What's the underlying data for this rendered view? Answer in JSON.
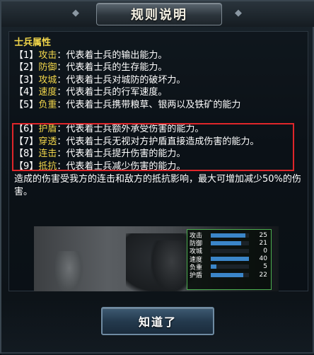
{
  "dialog": {
    "title": "规则说明",
    "ok_label": "知道了"
  },
  "section": {
    "title": "士兵属性"
  },
  "attributes": [
    {
      "num": "1",
      "name": "攻击",
      "desc": "代表着士兵的输出能力。"
    },
    {
      "num": "2",
      "name": "防御",
      "desc": "代表着士兵的生存能力。"
    },
    {
      "num": "3",
      "name": "攻城",
      "desc": "代表着士兵对城防的破坏力。"
    },
    {
      "num": "4",
      "name": "速度",
      "desc": "代表着士兵的行军速度。"
    },
    {
      "num": "5",
      "name": "负重",
      "desc": "代表着士兵携带粮草、银两以及铁矿的能力"
    },
    {
      "num": "6",
      "name": "护盾",
      "desc": "代表着士兵额外承受伤害的能力。"
    },
    {
      "num": "7",
      "name": "穿透",
      "desc": "代表着士兵无视对方护盾直接造成伤害的能力。"
    },
    {
      "num": "8",
      "name": "连击",
      "desc": "代表着士兵提升伤害的能力。"
    },
    {
      "num": "9",
      "name": "抵抗",
      "desc": "代表着士兵减少伤害的能力。"
    }
  ],
  "note": "造成的伤害受我方的连击和敌方的抵抗影响，最大可增加减少50%的伤害。",
  "stats": [
    {
      "label": "攻击",
      "value": "25",
      "fill": 0.9
    },
    {
      "label": "防御",
      "value": "21",
      "fill": 0.8
    },
    {
      "label": "攻城",
      "value": "0",
      "fill": 0.0
    },
    {
      "label": "速度",
      "value": "40",
      "fill": 1.0
    },
    {
      "label": "负重",
      "value": "5",
      "fill": 0.15
    },
    {
      "label": "护盾",
      "value": "22",
      "fill": 0.85
    }
  ],
  "colors": {
    "name": "#f2d64a",
    "highlight": "#e0262a",
    "stat_border": "#4caf50",
    "bar": "#3b86c9"
  }
}
